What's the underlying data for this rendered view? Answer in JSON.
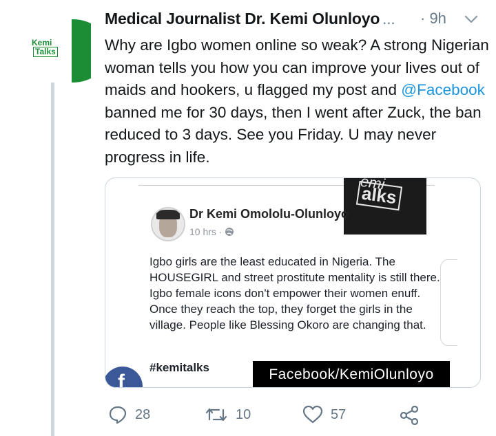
{
  "tweet": {
    "author": "Medical Journalist Dr. Kemi Olunloyo",
    "ellipsis": "...",
    "time": "· 9h",
    "text_before_mention": "Why are Igbo women online so weak? A strong Nigerian woman tells you how you can improve your lives out of maids and hookers, u flagged my post and ",
    "mention": "@Facebook",
    "text_after_mention": " banned me for 30 days, then I went after Zuck, the ban reduced to 3 days. See you Friday. U may never progress in life.",
    "avatar_logo_line1": "Kemi",
    "avatar_logo_line2": "Talks"
  },
  "embedded_post": {
    "name": "Dr Kemi Omololu-Olunloyo",
    "meta_time": "10 hrs ·",
    "body": "Igbo girls are the least educated in Nigeria. The HOUSEGIRL and street prostitute mentality is still there. Igbo female icons don't empower their women enuff. Once they reach the top, they forget the girls in the village. People like Blessing Okoro are changing that.",
    "hashtag": "#kemitalks",
    "caption": "Facebook/KemiOlunloyo",
    "logo_line1": "emi",
    "logo_line2": "alks",
    "fb_letter": "f"
  },
  "actions": {
    "reply_count": "28",
    "retweet_count": "10",
    "like_count": "57",
    "icons": [
      "reply-icon",
      "retweet-icon",
      "like-icon",
      "share-icon"
    ]
  },
  "colors": {
    "mention": "#1b95e0",
    "secondary_text": "#657786",
    "brand_green": "#1a8d35",
    "facebook_blue": "#3b5998"
  }
}
